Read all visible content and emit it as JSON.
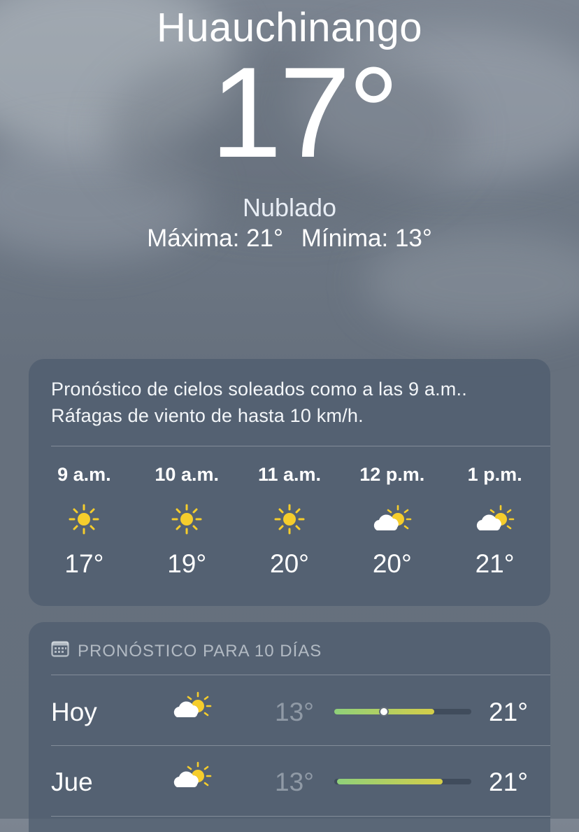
{
  "header": {
    "city": "Huauchinango",
    "temperature": "17°",
    "condition": "Nublado",
    "high": "Máxima: 21°",
    "low": "Mínima: 13°"
  },
  "hourly": {
    "summary_line1": "Pronóstico de cielos soleados como a las 9 a.m..",
    "summary_line2": "Ráfagas de viento de hasta 10 km/h.",
    "hours": [
      {
        "time": "9 a.m.",
        "icon": "sun-icon",
        "temp": "17°"
      },
      {
        "time": "10 a.m.",
        "icon": "sun-icon",
        "temp": "19°"
      },
      {
        "time": "11 a.m.",
        "icon": "sun-icon",
        "temp": "20°"
      },
      {
        "time": "12 p.m.",
        "icon": "partly-cloudy-icon",
        "temp": "20°"
      },
      {
        "time": "1 p.m.",
        "icon": "partly-cloudy-icon",
        "temp": "21°"
      }
    ]
  },
  "forecast": {
    "header": "PRONÓSTICO PARA 10 DÍAS",
    "header_icon": "calendar-icon",
    "days": [
      {
        "day": "Hoy",
        "icon": "partly-cloudy-icon",
        "low": "13°",
        "high": "21°",
        "range_start": 0.0,
        "range_end": 0.73,
        "current": 0.36
      },
      {
        "day": "Jue",
        "icon": "partly-cloudy-icon",
        "low": "13°",
        "high": "21°",
        "range_start": 0.02,
        "range_end": 0.79
      }
    ]
  },
  "colors": {
    "sun": "#f5cd2c",
    "bar_cool": "#8fd07a",
    "bar_warm": "#d5ce49"
  }
}
